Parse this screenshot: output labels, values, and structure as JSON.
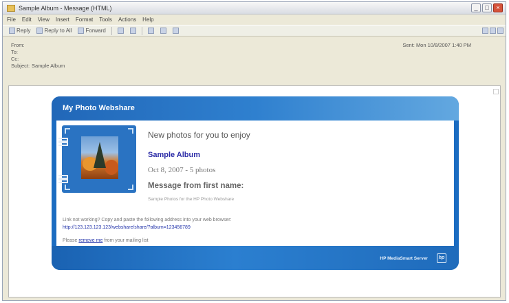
{
  "window": {
    "title": "Sample Album - Message (HTML)"
  },
  "menu": [
    "File",
    "Edit",
    "View",
    "Insert",
    "Format",
    "Tools",
    "Actions",
    "Help"
  ],
  "toolbar": {
    "reply": "Reply",
    "reply_all": "Reply to All",
    "forward": "Forward"
  },
  "header": {
    "from_label": "From:",
    "to_label": "To:",
    "cc_label": "Cc:",
    "subject_label": "Subject:",
    "subject_value": "Sample Album",
    "sent": "Sent: Mon 10/8/2007 1:40 PM"
  },
  "card": {
    "header_title": "My Photo Webshare",
    "headline": "New photos for you to enjoy",
    "album_name": "Sample Album",
    "album_meta": "Oct 8, 2007 - 5 photos",
    "message_title": "Message from first name:",
    "message_sub": "Sample Photos for the HP Photo Webshare",
    "notice": "Link not working? Copy and paste the following address into your web browser:",
    "link": "http://123.123.123.123/webshare/share/?album=123456789",
    "remove_prefix": "Please",
    "remove_link": "remove me",
    "remove_suffix": "from your mailing list",
    "brand": "HP MediaSmart Server",
    "logo_text": "hp"
  },
  "colors": {
    "card_blue": "#1b6cc1",
    "link_blue": "#2233aa",
    "album_blue": "#2e2ea8"
  }
}
